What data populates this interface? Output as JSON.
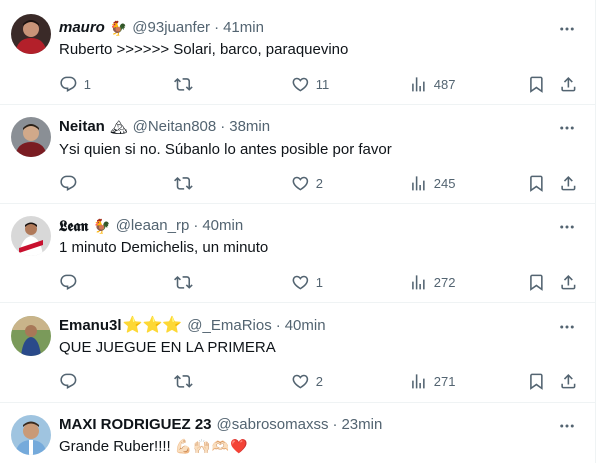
{
  "tweets": [
    {
      "name": "mauro",
      "emoji": "🐓",
      "handle": "@93juanfer",
      "time": "41min",
      "text": "Ruberto >>>>>> Solari, barco, paraquevino",
      "replies": "1",
      "retweets": "",
      "likes": "11",
      "views": "487"
    },
    {
      "name": "Neitan",
      "emoji": "🏔",
      "handle": "@Neitan808",
      "time": "38min",
      "text": "Ysi quien si no. Súbanlo lo antes posible por favor",
      "replies": "",
      "retweets": "",
      "likes": "2",
      "views": "245"
    },
    {
      "name": "𝕷𝖊𝖆𝖓",
      "emoji": "🐓",
      "handle": "@leaan_rp",
      "time": "40min",
      "text": "1 minuto Demichelis, un minuto",
      "replies": "",
      "retweets": "",
      "likes": "1",
      "views": "272"
    },
    {
      "name": "Emanu3l",
      "emoji": "⭐⭐⭐",
      "handle": "@_EmaRios",
      "time": "40min",
      "text": "QUE JUEGUE EN LA PRIMERA",
      "replies": "",
      "retweets": "",
      "likes": "2",
      "views": "271"
    },
    {
      "name": "MAXI RODRIGUEZ 23",
      "emoji": "",
      "handle": "@sabrosomaxss",
      "time": "23min",
      "text": "Grande Ruber!!!!",
      "text_emoji": "💪🏻🙌🏻🫶🏻❤️"
    }
  ],
  "dot": "·",
  "colors": {
    "text": "#0f1419",
    "secondary": "#536471",
    "border": "#eff3f4"
  }
}
